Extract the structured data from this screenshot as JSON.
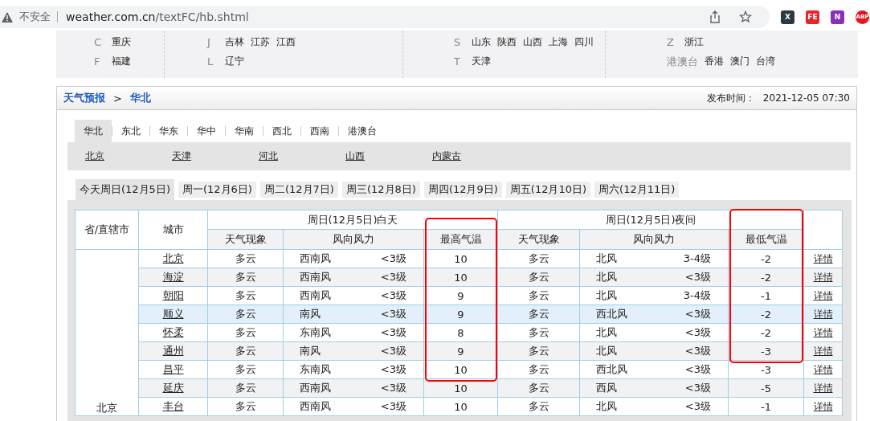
{
  "browser": {
    "security": "不安全",
    "url_host": "weather.com.cn",
    "url_path": "/textFC/hb.shtml",
    "extensions": [
      {
        "label": "X",
        "color": "#2b3a42"
      },
      {
        "label": "FE",
        "color": "#e8262a"
      },
      {
        "label": "N",
        "color": "#8a2fb8"
      },
      {
        "label": "ABP",
        "color": "#e5161c"
      }
    ]
  },
  "province_index": [
    {
      "groups": [
        {
          "letter": "C",
          "provinces": [
            "重庆"
          ]
        },
        {
          "letter": "F",
          "provinces": [
            "福建"
          ]
        }
      ]
    },
    {
      "groups": [
        {
          "letter": "J",
          "provinces": [
            "吉林",
            "江苏",
            "江西"
          ]
        },
        {
          "letter": "L",
          "provinces": [
            "辽宁"
          ]
        }
      ]
    },
    {
      "groups": [
        {
          "letter": "S",
          "provinces": [
            "山东",
            "陕西",
            "山西",
            "上海",
            "四川"
          ]
        },
        {
          "letter": "T",
          "provinces": [
            "天津"
          ]
        }
      ]
    },
    {
      "groups": [
        {
          "letter": "Z",
          "provinces": [
            "浙江"
          ]
        },
        {
          "letter": "港澳台",
          "provinces": [
            "香港",
            "澳门",
            "台湾"
          ]
        }
      ]
    }
  ],
  "breadcrumb": {
    "home": "天气预报",
    "separator": ">",
    "current": "华北"
  },
  "publish": {
    "label": "发布时间：",
    "time": "2021-12-05 07:30"
  },
  "region_tabs": [
    {
      "label": "华北",
      "selected": true
    },
    {
      "label": "东北",
      "selected": false
    },
    {
      "label": "华东",
      "selected": false
    },
    {
      "label": "华中",
      "selected": false
    },
    {
      "label": "华南",
      "selected": false
    },
    {
      "label": "西北",
      "selected": false
    },
    {
      "label": "西南",
      "selected": false
    },
    {
      "label": "港澳台",
      "selected": false
    }
  ],
  "provinces": [
    "北京",
    "天津",
    "河北",
    "山西",
    "内蒙古"
  ],
  "day_tabs": [
    {
      "label": "今天周日(12月5日)",
      "selected": true
    },
    {
      "label": "周一(12月6日)",
      "selected": false
    },
    {
      "label": "周二(12月7日)",
      "selected": false
    },
    {
      "label": "周三(12月8日)",
      "selected": false
    },
    {
      "label": "周四(12月9日)",
      "selected": false
    },
    {
      "label": "周五(12月10日)",
      "selected": false
    },
    {
      "label": "周六(12月11日)",
      "selected": false
    }
  ],
  "table": {
    "province_header": "省/直辖市",
    "city_header": "城市",
    "day_header": "周日(12月5日)白天",
    "night_header": "周日(12月5日)夜间",
    "day_columns": [
      {
        "label": "天气现象",
        "boxed": false
      },
      {
        "label": "风向风力",
        "boxed": false
      },
      {
        "label": "最高气温",
        "boxed": true
      }
    ],
    "night_columns": [
      {
        "label": "天气现象",
        "boxed": false
      },
      {
        "label": "风向风力",
        "boxed": false
      },
      {
        "label": "最低气温",
        "boxed": true
      }
    ],
    "province": "北京",
    "rows": [
      {
        "city": "北京",
        "day_weather": "多云",
        "day_wind_dir": "西南风",
        "day_wind_level": "<3级",
        "high": "10",
        "night_weather": "多云",
        "night_wind_dir": "北风",
        "night_wind_level": "3-4级",
        "low": "-2",
        "details": "详情",
        "highlighted": false
      },
      {
        "city": "海淀",
        "day_weather": "多云",
        "day_wind_dir": "西南风",
        "day_wind_level": "<3级",
        "high": "10",
        "night_weather": "多云",
        "night_wind_dir": "北风",
        "night_wind_level": "<3级",
        "low": "-2",
        "details": "详情",
        "highlighted": false
      },
      {
        "city": "朝阳",
        "day_weather": "多云",
        "day_wind_dir": "西南风",
        "day_wind_level": "<3级",
        "high": "9",
        "night_weather": "多云",
        "night_wind_dir": "北风",
        "night_wind_level": "3-4级",
        "low": "-1",
        "details": "详情",
        "highlighted": false
      },
      {
        "city": "顺义",
        "day_weather": "多云",
        "day_wind_dir": "南风",
        "day_wind_level": "<3级",
        "high": "9",
        "night_weather": "多云",
        "night_wind_dir": "西北风",
        "night_wind_level": "<3级",
        "low": "-2",
        "details": "详情",
        "highlighted": true
      },
      {
        "city": "怀柔",
        "day_weather": "多云",
        "day_wind_dir": "东南风",
        "day_wind_level": "<3级",
        "high": "8",
        "night_weather": "多云",
        "night_wind_dir": "北风",
        "night_wind_level": "<3级",
        "low": "-2",
        "details": "详情",
        "highlighted": false
      },
      {
        "city": "通州",
        "day_weather": "多云",
        "day_wind_dir": "南风",
        "day_wind_level": "<3级",
        "high": "9",
        "night_weather": "多云",
        "night_wind_dir": "北风",
        "night_wind_level": "<3级",
        "low": "-3",
        "details": "详情",
        "highlighted": false
      },
      {
        "city": "昌平",
        "day_weather": "多云",
        "day_wind_dir": "东南风",
        "day_wind_level": "<3级",
        "high": "10",
        "night_weather": "多云",
        "night_wind_dir": "西北风",
        "night_wind_level": "<3级",
        "low": "-3",
        "details": "详情",
        "highlighted": false
      },
      {
        "city": "延庆",
        "day_weather": "多云",
        "day_wind_dir": "西南风",
        "day_wind_level": "<3级",
        "high": "10",
        "night_weather": "多云",
        "night_wind_dir": "西风",
        "night_wind_level": "<3级",
        "low": "-5",
        "details": "详情",
        "highlighted": false
      },
      {
        "city": "丰台",
        "day_weather": "多云",
        "day_wind_dir": "西南风",
        "day_wind_level": "<3级",
        "high": "10",
        "night_weather": "多云",
        "night_wind_dir": "北风",
        "night_wind_level": "<3级",
        "low": "-1",
        "details": "详情",
        "highlighted": false
      }
    ]
  }
}
